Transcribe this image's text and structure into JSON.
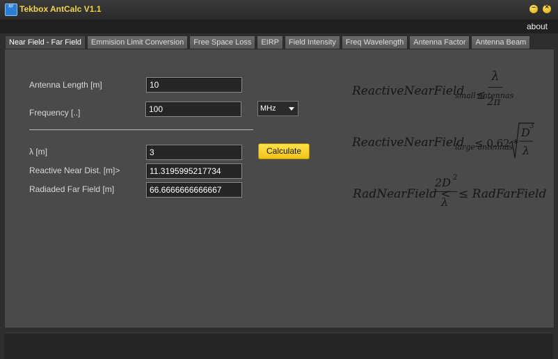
{
  "window": {
    "title": "Tekbox AntCalc V1.1",
    "icon_text": "RF"
  },
  "menu": {
    "about": "about"
  },
  "tabs": [
    "Near Field - Far Field",
    "Emmision Limit Conversion",
    "Free Space Loss",
    "EIRP",
    "Field Intensity",
    "Freq Wavelength",
    "Antenna Factor",
    "Antenna Beam"
  ],
  "form": {
    "antenna_length": {
      "label": "Antenna Length [m]",
      "value": "10"
    },
    "frequency": {
      "label": "Frequency [..]",
      "value": "100",
      "unit": "MHz"
    },
    "lambda": {
      "label": "λ [m]",
      "value": "3"
    },
    "reactive_near": {
      "label": "Reactive Near Dist. [m]>",
      "value": "11.3195995217734"
    },
    "radiated_far": {
      "label": "Radiaded Far Field [m]",
      "value": "66.6666666666667"
    },
    "calculate": "Calculate"
  },
  "formulas": {
    "f1_lhs": "ReactiveNearField",
    "f1_sub": "small antennas",
    "f1_rel": "≤",
    "f1_num": "λ",
    "f1_den": "2π",
    "f2_lhs": "ReactiveNearField",
    "f2_sub": "large antennas",
    "f2_rel": "≤ 0.62 *",
    "f2_num": "D",
    "f2_num_exp": "3",
    "f2_den": "λ",
    "f3_lhs": "RadNearField <",
    "f3_num": "2D",
    "f3_num_exp": "2",
    "f3_den": "λ",
    "f3_rhs": "≤ RadFarField"
  }
}
